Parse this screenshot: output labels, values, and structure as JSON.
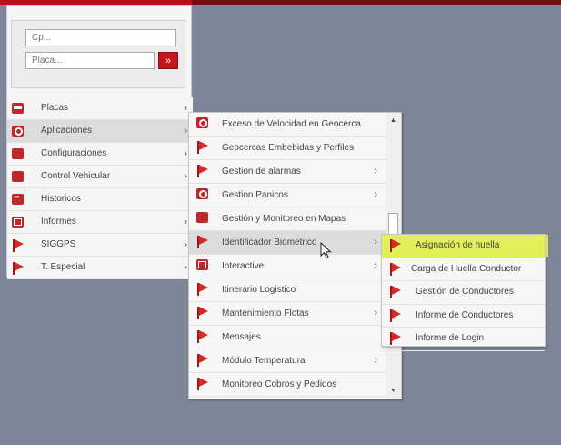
{
  "search": {
    "field1_placeholder": "Cp...",
    "field2_placeholder": "Placa...",
    "go_glyph": "»"
  },
  "menu": {
    "items": [
      {
        "label": "Placas",
        "icon": "bar-icon",
        "arrow": "›"
      },
      {
        "label": "Aplicaciones",
        "icon": "gear-icon",
        "arrow": "›"
      },
      {
        "label": "Configuraciones",
        "icon": "red-square-icon",
        "arrow": "›"
      },
      {
        "label": "Control Vehicular",
        "icon": "red-square-icon",
        "arrow": "›"
      },
      {
        "label": "Historicos",
        "icon": "dots-icon",
        "arrow": ""
      },
      {
        "label": "Informes",
        "icon": "document-icon",
        "arrow": "›"
      },
      {
        "label": "SIGGPS",
        "icon": "flag-icon",
        "arrow": "›"
      },
      {
        "label": "T. Especial",
        "icon": "flag-icon",
        "arrow": "›"
      }
    ]
  },
  "submenu1": {
    "items": [
      {
        "label": "Exceso de Velocidad en Geocerca",
        "icon": "gear-icon",
        "arrow": ""
      },
      {
        "label": "Geocercas Embebidas y Perfiles",
        "icon": "flag-icon",
        "arrow": ""
      },
      {
        "label": "Gestion de alarmas",
        "icon": "flag-icon",
        "arrow": "›"
      },
      {
        "label": "Gestion Panicos",
        "icon": "gear-icon",
        "arrow": "›"
      },
      {
        "label": "Gestión y Monitoreo en Mapas",
        "icon": "red-square-icon",
        "arrow": ""
      },
      {
        "label": "Identificador Biometrico",
        "icon": "flag-icon",
        "arrow": "›"
      },
      {
        "label": "Interactive",
        "icon": "document-icon",
        "arrow": "›"
      },
      {
        "label": "Itinerario Logistico",
        "icon": "flag-icon",
        "arrow": ""
      },
      {
        "label": "Mantenimiento Flotas",
        "icon": "flag-icon",
        "arrow": "›"
      },
      {
        "label": "Mensajes",
        "icon": "flag-icon",
        "arrow": ""
      },
      {
        "label": "Módulo Temperatura",
        "icon": "flag-icon",
        "arrow": "›"
      },
      {
        "label": "Monitoreo Cobros y Pedidos",
        "icon": "flag-icon",
        "arrow": ""
      }
    ],
    "scroll_up": "▲",
    "scroll_down": "▼"
  },
  "submenu2": {
    "items": [
      {
        "label": "Asignación de huella",
        "icon": "flag-icon"
      },
      {
        "label": "Carga de Huella Conductor",
        "icon": "flag-icon"
      },
      {
        "label": "Gestión de Conductores",
        "icon": "flag-icon"
      },
      {
        "label": "Informe de Conductores",
        "icon": "flag-icon"
      },
      {
        "label": "Informe de Login",
        "icon": "flag-icon"
      }
    ]
  },
  "colors": {
    "accent": "#c4161c",
    "highlight": "#e3ef58",
    "background": "#7d8598"
  }
}
